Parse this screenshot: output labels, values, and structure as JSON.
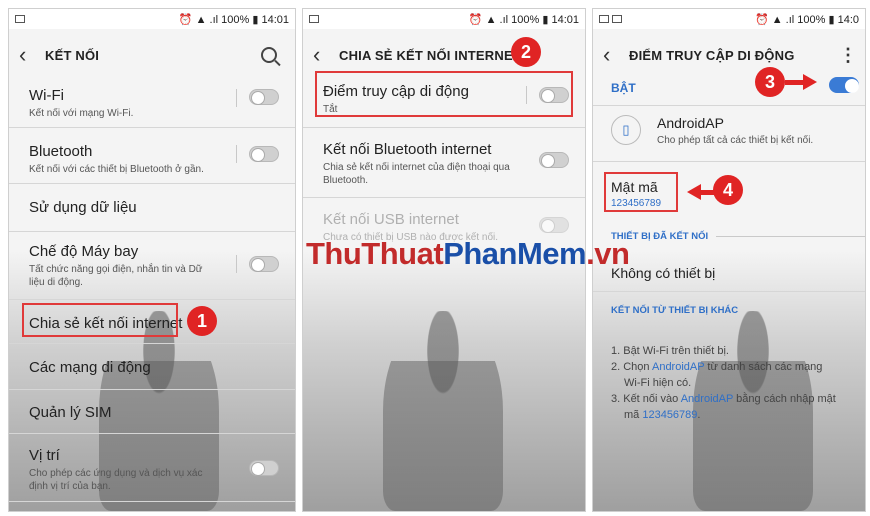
{
  "status_bar": {
    "battery": "100%",
    "time": "14:01",
    "time_clipped": "14:0"
  },
  "screen1": {
    "title": "KẾT NỐI",
    "items": [
      {
        "title": "Wi-Fi",
        "subtitle": "Kết nối với mạng Wi-Fi."
      },
      {
        "title": "Bluetooth",
        "subtitle": "Kết nối với các thiết bị Bluetooth ở gần."
      },
      {
        "title": "Sử dụng dữ liệu"
      },
      {
        "title": "Chế độ Máy bay",
        "subtitle": "Tất chức năng gọi điện, nhắn tin và Dữ liệu di động."
      },
      {
        "title": "Chia sẻ kết nối internet"
      },
      {
        "title": "Các mạng di động"
      },
      {
        "title": "Quản lý SIM"
      },
      {
        "title": "Vị trí",
        "subtitle": "Cho phép các ứng dụng và dịch vụ xác định vị trí của bạn."
      }
    ],
    "step": "1"
  },
  "screen2": {
    "title": "CHIA SẺ KẾT NỐI INTERNET",
    "items": [
      {
        "title": "Điểm truy cập di động",
        "subtitle": "Tắt"
      },
      {
        "title": "Kết nối Bluetooth internet",
        "subtitle": "Chia sẻ kết nối internet của điện thoại qua Bluetooth."
      },
      {
        "title": "Kết nối USB internet",
        "subtitle": "Chưa có thiết bị USB nào được kết nối."
      }
    ],
    "step": "2"
  },
  "screen3": {
    "title": "ĐIỂM TRUY CẬP DI ĐỘNG",
    "on_label": "BẬT",
    "ap_name": "AndroidAP",
    "ap_desc": "Cho phép tất cả các thiết bị kết nối.",
    "password_label": "Mật mã",
    "password": "123456789",
    "connected_header": "THIẾT BỊ ĐÃ KẾT NỐI",
    "no_device": "Không có thiết bị",
    "other_header": "KẾT NỐI TỪ THIẾT BỊ KHÁC",
    "instructions": {
      "l1": "1. Bật Wi-Fi trên thiết bị.",
      "l2a": "2. Chọn ",
      "l2b": "AndroidAP",
      "l2c": " từ danh sách các mạng",
      "l2d": "Wi-Fi hiện có.",
      "l3a": "3. Kết nối vào ",
      "l3b": "AndroidAP",
      "l3c": " bằng cách nhập mật",
      "l3d": "mã ",
      "l3e": "123456789",
      "l3f": "."
    },
    "step3": "3",
    "step4": "4"
  },
  "watermark": {
    "part1": "ThuThuat",
    "part2": "PhanMem",
    "part3": ".vn"
  },
  "colors": {
    "accent": "#3a7bd5",
    "callout": "#e02424",
    "watermark_red": "#c22b2b",
    "watermark_blue": "#1a4fa8"
  }
}
